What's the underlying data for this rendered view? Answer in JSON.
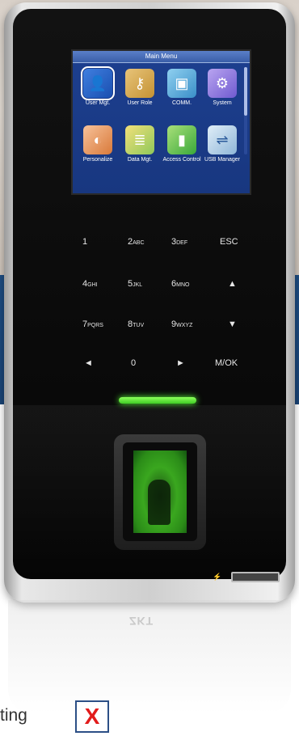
{
  "screen": {
    "title": "Main Menu",
    "items": [
      {
        "label": "User Mgt.",
        "icon": "user-icon",
        "selected": true
      },
      {
        "label": "User Role",
        "icon": "key-icon",
        "selected": false
      },
      {
        "label": "COMM.",
        "icon": "network-icon",
        "selected": false
      },
      {
        "label": "System",
        "icon": "gear-icon",
        "selected": false
      },
      {
        "label": "Personalize",
        "icon": "palette-icon",
        "selected": false
      },
      {
        "label": "Data Mgt.",
        "icon": "database-icon",
        "selected": false
      },
      {
        "label": "Access Control",
        "icon": "door-icon",
        "selected": false
      },
      {
        "label": "USB Manager",
        "icon": "usb-icon",
        "selected": false
      }
    ]
  },
  "keypad": {
    "rows": [
      [
        {
          "main": "1",
          "sub": ""
        },
        {
          "main": "2",
          "sub": "ABC"
        },
        {
          "main": "3",
          "sub": "DEF"
        },
        {
          "main": "ESC",
          "sub": ""
        }
      ],
      [
        {
          "main": "4",
          "sub": "GHI"
        },
        {
          "main": "5",
          "sub": "JKL"
        },
        {
          "main": "6",
          "sub": "MNO"
        },
        {
          "main": "▲",
          "sub": ""
        }
      ],
      [
        {
          "main": "7",
          "sub": "PQRS"
        },
        {
          "main": "8",
          "sub": "TUV"
        },
        {
          "main": "9",
          "sub": "WXYZ"
        },
        {
          "main": "▼",
          "sub": ""
        }
      ],
      [
        {
          "main": "◄",
          "sub": ""
        },
        {
          "main": "0",
          "sub": ""
        },
        {
          "main": "►",
          "sub": ""
        },
        {
          "main": "M/OK",
          "sub": ""
        }
      ]
    ]
  },
  "brand_reflection": "ZKT",
  "caption": "ting",
  "close_mark": "X",
  "colors": {
    "led": "#5cff3a",
    "band": "#1d4d83",
    "screen": "#1d3f8f",
    "close_mark": "#e21b1b"
  }
}
